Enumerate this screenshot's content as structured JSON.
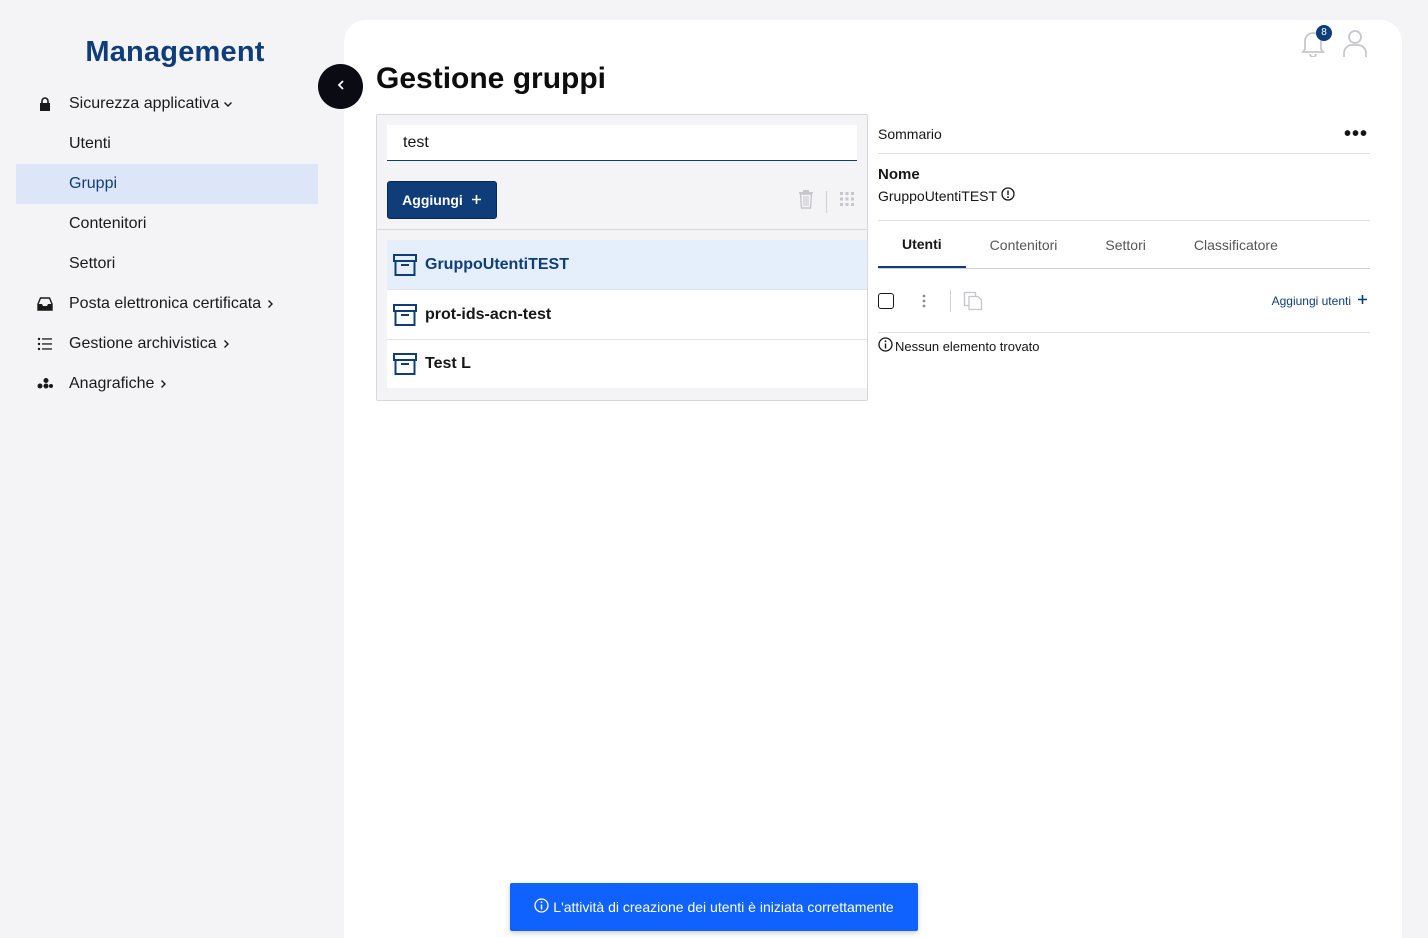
{
  "sidebar": {
    "brand": "Management",
    "items": [
      {
        "label": "Sicurezza applicativa",
        "icon": "lock-icon",
        "expanded": true
      },
      {
        "label": "Utenti"
      },
      {
        "label": "Gruppi",
        "active": true
      },
      {
        "label": "Contenitori"
      },
      {
        "label": "Settori"
      },
      {
        "label": "Posta elettronica certificata",
        "icon": "inbox-icon"
      },
      {
        "label": "Gestione archivistica",
        "icon": "list-icon"
      },
      {
        "label": "Anagrafiche",
        "icon": "grid-icon"
      }
    ]
  },
  "header": {
    "title": "Gestione gruppi",
    "notifications_count": "8"
  },
  "groups_panel": {
    "search_value": "test",
    "add_label": "Aggiungi",
    "items": [
      {
        "label": "GruppoUtentiTEST",
        "selected": true
      },
      {
        "label": "prot-ids-acn-test"
      },
      {
        "label": "Test L"
      }
    ]
  },
  "summary": {
    "title": "Sommario",
    "name_label": "Nome",
    "name_value": "GruppoUtentiTEST",
    "tabs": [
      {
        "label": "Utenti",
        "active": true
      },
      {
        "label": "Contenitori"
      },
      {
        "label": "Settori"
      },
      {
        "label": "Classificatore"
      }
    ],
    "add_users_label": "Aggiungi utenti",
    "empty_text": "Nessun elemento trovato"
  },
  "toast": {
    "message": "L'attività di creazione dei utenti è iniziata correttamente"
  },
  "colors": {
    "brand": "#0f3d7a",
    "toast": "#0f62fe",
    "selected_bg": "#e5eefb"
  }
}
